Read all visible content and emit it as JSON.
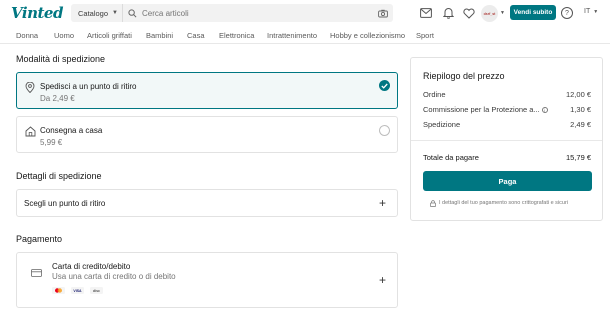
{
  "header": {
    "logo": "Vinted",
    "catalog_label": "Catalogo",
    "search_placeholder": "Cerca articoli",
    "avatar_text": "dsrf_st",
    "sell_button": "Vendi subito",
    "help_label": "?",
    "language": "IT",
    "brand_color": "#007782"
  },
  "categories": [
    "Donna",
    "Uomo",
    "Articoli griffati",
    "Bambini",
    "Casa",
    "Elettronica",
    "Intrattenimento",
    "Hobby e collezionismo",
    "Sport"
  ],
  "shipping_mode": {
    "title": "Modalità di spedizione",
    "options": [
      {
        "title": "Spedisci a un punto di ritiro",
        "price": "Da 2,49 €",
        "selected": true
      },
      {
        "title": "Consegna a casa",
        "price": "5,99 €",
        "selected": false
      }
    ]
  },
  "shipping_details": {
    "title": "Dettagli di spedizione",
    "pickup_label": "Scegli un punto di ritiro"
  },
  "payment": {
    "title": "Pagamento",
    "method_title": "Carta di credito/debito",
    "method_subtitle": "Usa una carta di credito o di debito",
    "card_logos": [
      "Mastercard",
      "VISA",
      "discover"
    ]
  },
  "summary": {
    "title": "Riepilogo del prezzo",
    "rows": [
      {
        "label": "Ordine",
        "value": "12,00 €"
      },
      {
        "label": "Commissione per la Protezione a...",
        "value": "1,30 €"
      },
      {
        "label": "Spedizione",
        "value": "2,49 €"
      }
    ],
    "total_label": "Totale da pagare",
    "total_value": "15,79 €",
    "pay_button": "Paga",
    "secure_note": "I dettagli del tuo pagamento sono crittografati e sicuri"
  }
}
